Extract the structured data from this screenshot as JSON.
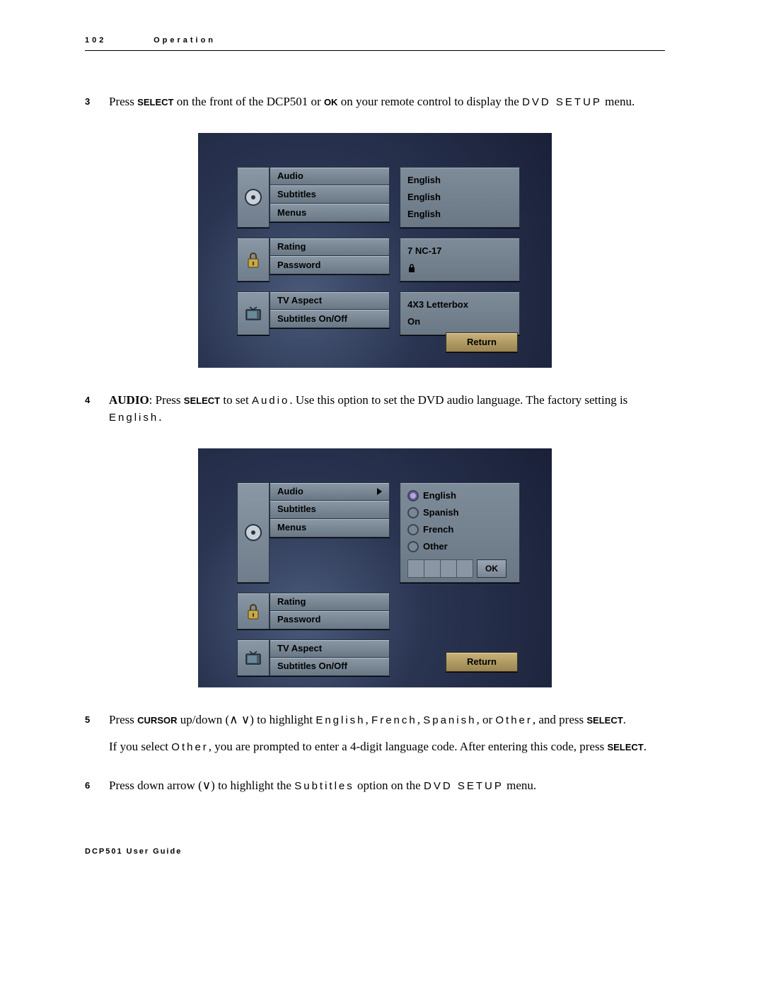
{
  "header": {
    "page_number": "102",
    "section": "Operation"
  },
  "footer": "DCP501 User Guide",
  "steps": {
    "s3": {
      "num": "3",
      "pre": "Press ",
      "kw1": "SELECT",
      "mid1": " on the front of the DCP501 or ",
      "kw2": "OK",
      "mid2": " on your remote control to display the ",
      "mono1": "DVD SETUP",
      "post": " menu."
    },
    "s4": {
      "num": "4",
      "bold": "AUDIO",
      "pre": ": Press ",
      "kw1": "SELECT",
      "mid1": " to set ",
      "mono1": "Audio",
      "mid2": ". Use this option to set the DVD audio language. The factory setting is ",
      "mono2": "English",
      "post": "."
    },
    "s5": {
      "num": "5",
      "pre": "Press ",
      "kw1": "CURSOR",
      "mid1": " up/down (∧ ∨) to highlight ",
      "m1": "English",
      "c1": ", ",
      "m2": "French",
      "c2": ", ",
      "m3": "Spanish",
      "c3": ", or ",
      "m4": "Other",
      "mid2": ", and press ",
      "kw2": "SELECT",
      "post": ".",
      "para2a": "If you select ",
      "para2m": "Other",
      "para2b": ", you are prompted to enter a 4-digit language code. After entering this code, press ",
      "para2kw": "SELECT",
      "para2c": "."
    },
    "s6": {
      "num": "6",
      "pre": "Press down arrow (∨) to highlight the ",
      "m1": "Subtitles",
      "mid": " option on the ",
      "m2": "DVD SETUP",
      "post": " menu."
    }
  },
  "screen1": {
    "group1": {
      "labels": [
        "Audio",
        "Subtitles",
        "Menus"
      ],
      "values": [
        "English",
        "English",
        "English"
      ]
    },
    "group2": {
      "labels": [
        "Rating",
        "Password"
      ],
      "values": [
        "7 NC-17",
        ""
      ]
    },
    "group3": {
      "labels": [
        "TV Aspect",
        "Subtitles On/Off"
      ],
      "values": [
        "4X3 Letterbox",
        "On"
      ]
    },
    "return": "Return"
  },
  "screen2": {
    "group1": {
      "labels": [
        "Audio",
        "Subtitles",
        "Menus"
      ]
    },
    "group2": {
      "labels": [
        "Rating",
        "Password"
      ]
    },
    "group3": {
      "labels": [
        "TV Aspect",
        "Subtitles On/Off"
      ]
    },
    "options": [
      "English",
      "Spanish",
      "French",
      "Other"
    ],
    "ok": "OK",
    "return": "Return"
  }
}
